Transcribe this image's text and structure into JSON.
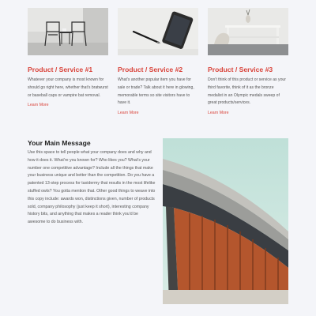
{
  "services": [
    {
      "title": "Product / Service #1",
      "text": "Whatever your company is most known for should go right here, whether that's bratwurst or baseball caps or vampire bat removal.",
      "link": "Learn More",
      "image_icon": "chairs-photo"
    },
    {
      "title": "Product / Service #2",
      "text": "What's another popular item you have for sale or trade? Talk about it here in glowing, memorable terms so site visitors have to have it.",
      "link": "Learn More",
      "image_icon": "tablet-pen-photo"
    },
    {
      "title": "Product / Service #3",
      "text": "Don't think of this product or service as your third favorite, think of it as the bronze medalist in an Olympic medals sweep of great products/services.",
      "link": "Learn More",
      "image_icon": "bench-vase-photo"
    }
  ],
  "main": {
    "heading": "Your Main Message",
    "body": "Use this space to tell people what your company does and why and how it does it. What're you known for? Who likes you? What's your number one competitive advantage? Include all the things that make your business unique and better than the competition. Do you have a patented 13-step process for taxidermy that results in the most lifelike stuffed owls? You gotta mention that. Other good things to weave into this copy include: awards won, distinctions given, number of products sold, company philosophy (just keep it short), interesting company history bits, and anything that makes a reader think you'd be awesome to do business with.",
    "image_icon": "architecture-photo"
  },
  "colors": {
    "accent": "#d9443b",
    "background": "#f4f5f9",
    "heading": "#222222"
  }
}
